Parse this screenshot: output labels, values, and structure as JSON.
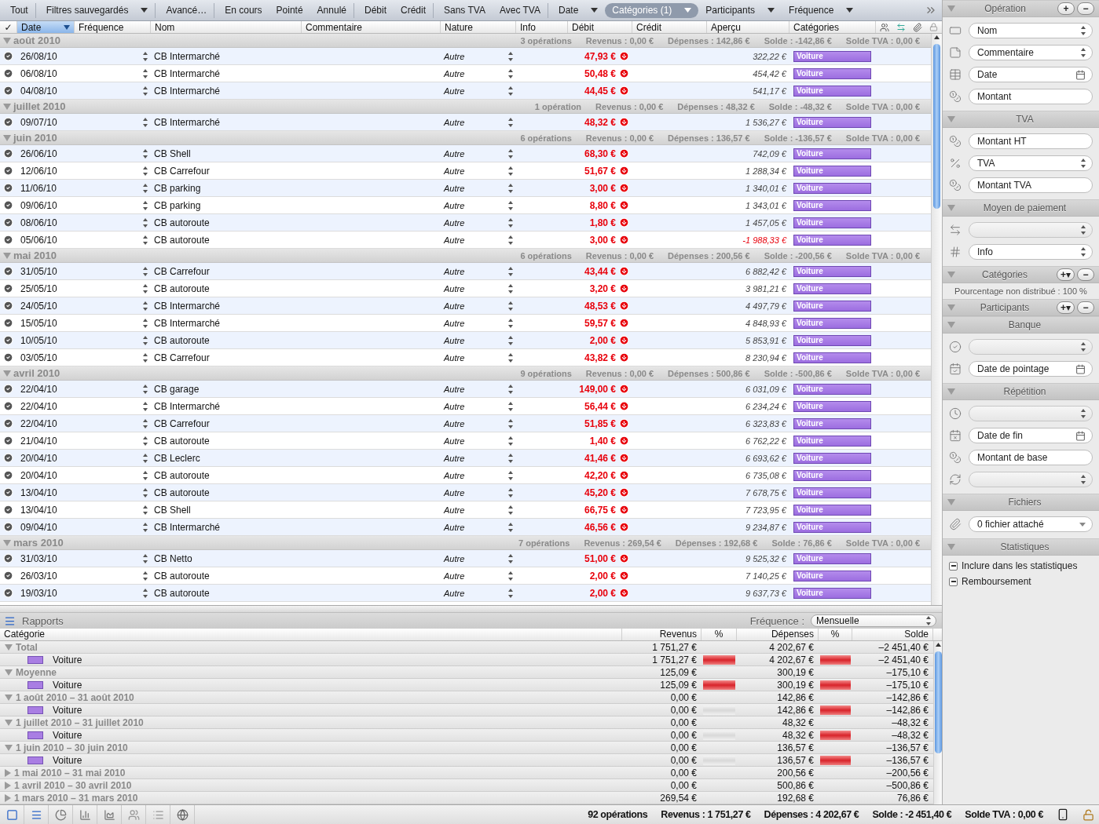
{
  "filters": [
    {
      "label": "Tout",
      "dropdown": false,
      "selected": false,
      "separator_after": true
    },
    {
      "label": "Filtres sauvegardés",
      "dropdown": true,
      "selected": false,
      "separator_after": true
    },
    {
      "label": "Avancé…",
      "dropdown": false,
      "selected": false,
      "separator_after": true
    },
    {
      "label": "En cours",
      "dropdown": false,
      "selected": false,
      "separator_after": false
    },
    {
      "label": "Pointé",
      "dropdown": false,
      "selected": false,
      "separator_after": false
    },
    {
      "label": "Annulé",
      "dropdown": false,
      "selected": false,
      "separator_after": true
    },
    {
      "label": "Débit",
      "dropdown": false,
      "selected": false,
      "separator_after": false
    },
    {
      "label": "Crédit",
      "dropdown": false,
      "selected": false,
      "separator_after": true
    },
    {
      "label": "Sans TVA",
      "dropdown": false,
      "selected": false,
      "separator_after": false
    },
    {
      "label": "Avec TVA",
      "dropdown": false,
      "selected": false,
      "separator_after": true
    },
    {
      "label": "Date",
      "dropdown": true,
      "selected": false,
      "separator_after": false
    },
    {
      "label": "Catégories (1)",
      "dropdown": true,
      "selected": true,
      "separator_after": false
    },
    {
      "label": "Participants",
      "dropdown": true,
      "selected": false,
      "separator_after": false
    },
    {
      "label": "Fréquence",
      "dropdown": true,
      "selected": false,
      "separator_after": false
    }
  ],
  "columns": [
    {
      "label": "✓",
      "selected": false
    },
    {
      "label": "Date",
      "selected": true
    },
    {
      "label": "Fréquence",
      "selected": false
    },
    {
      "label": "Nom",
      "selected": false
    },
    {
      "label": "Commentaire",
      "selected": false
    },
    {
      "label": "Nature",
      "selected": false
    },
    {
      "label": "Info",
      "selected": false
    },
    {
      "label": "Débit",
      "selected": false
    },
    {
      "label": "Crédit",
      "selected": false
    },
    {
      "label": "Aperçu",
      "selected": false
    },
    {
      "label": "Catégories",
      "selected": false
    }
  ],
  "groups": [
    {
      "month": "août 2010",
      "expanded": true,
      "summary": [
        "3 opérations",
        "Revenus : 0,00 €",
        "Dépenses : 142,86 €",
        "Solde : -142,86 €",
        "Solde TVA : 0,00 €"
      ],
      "rows": [
        {
          "checked": true,
          "date": "26/08/10",
          "name": "CB Intermarché",
          "nature": "Autre",
          "debit": "47,93 €",
          "apercu": "322,22 €",
          "negative": false,
          "category": "Voiture"
        },
        {
          "checked": true,
          "date": "06/08/10",
          "name": "CB Intermarché",
          "nature": "Autre",
          "debit": "50,48 €",
          "apercu": "454,42 €",
          "negative": false,
          "category": "Voiture"
        },
        {
          "checked": true,
          "date": "04/08/10",
          "name": "CB Intermarché",
          "nature": "Autre",
          "debit": "44,45 €",
          "apercu": "541,17 €",
          "negative": false,
          "category": "Voiture"
        }
      ]
    },
    {
      "month": "juillet 2010",
      "expanded": true,
      "summary": [
        "1 opération",
        "Revenus : 0,00 €",
        "Dépenses : 48,32 €",
        "Solde : -48,32 €",
        "Solde TVA : 0,00 €"
      ],
      "rows": [
        {
          "checked": true,
          "date": "09/07/10",
          "name": "CB Intermarché",
          "nature": "Autre",
          "debit": "48,32 €",
          "apercu": "1 536,27 €",
          "negative": false,
          "category": "Voiture"
        }
      ]
    },
    {
      "month": "juin 2010",
      "expanded": true,
      "summary": [
        "6 opérations",
        "Revenus : 0,00 €",
        "Dépenses : 136,57 €",
        "Solde : -136,57 €",
        "Solde TVA : 0,00 €"
      ],
      "rows": [
        {
          "checked": true,
          "date": "26/06/10",
          "name": "CB Shell",
          "nature": "Autre",
          "debit": "68,30 €",
          "apercu": "742,09 €",
          "negative": false,
          "category": "Voiture"
        },
        {
          "checked": true,
          "date": "12/06/10",
          "name": "CB Carrefour",
          "nature": "Autre",
          "debit": "51,67 €",
          "apercu": "1 288,34 €",
          "negative": false,
          "category": "Voiture"
        },
        {
          "checked": true,
          "date": "11/06/10",
          "name": "CB parking",
          "nature": "Autre",
          "debit": "3,00 €",
          "apercu": "1 340,01 €",
          "negative": false,
          "category": "Voiture"
        },
        {
          "checked": true,
          "date": "09/06/10",
          "name": "CB parking",
          "nature": "Autre",
          "debit": "8,80 €",
          "apercu": "1 343,01 €",
          "negative": false,
          "category": "Voiture"
        },
        {
          "checked": true,
          "date": "08/06/10",
          "name": "CB autoroute",
          "nature": "Autre",
          "debit": "1,80 €",
          "apercu": "1 457,05 €",
          "negative": false,
          "category": "Voiture"
        },
        {
          "checked": true,
          "date": "05/06/10",
          "name": "CB autoroute",
          "nature": "Autre",
          "debit": "3,00 €",
          "apercu": "-1 988,33 €",
          "negative": true,
          "category": "Voiture"
        }
      ]
    },
    {
      "month": "mai 2010",
      "expanded": true,
      "summary": [
        "6 opérations",
        "Revenus : 0,00 €",
        "Dépenses : 200,56 €",
        "Solde : -200,56 €",
        "Solde TVA : 0,00 €"
      ],
      "rows": [
        {
          "checked": true,
          "date": "31/05/10",
          "name": "CB Carrefour",
          "nature": "Autre",
          "debit": "43,44 €",
          "apercu": "6 882,42 €",
          "negative": false,
          "category": "Voiture"
        },
        {
          "checked": true,
          "date": "25/05/10",
          "name": "CB autoroute",
          "nature": "Autre",
          "debit": "3,20 €",
          "apercu": "3 981,21 €",
          "negative": false,
          "category": "Voiture"
        },
        {
          "checked": true,
          "date": "24/05/10",
          "name": "CB Intermarché",
          "nature": "Autre",
          "debit": "48,53 €",
          "apercu": "4 497,79 €",
          "negative": false,
          "category": "Voiture"
        },
        {
          "checked": true,
          "date": "15/05/10",
          "name": "CB Intermarché",
          "nature": "Autre",
          "debit": "59,57 €",
          "apercu": "4 848,93 €",
          "negative": false,
          "category": "Voiture"
        },
        {
          "checked": true,
          "date": "10/05/10",
          "name": "CB autoroute",
          "nature": "Autre",
          "debit": "2,00 €",
          "apercu": "5 853,91 €",
          "negative": false,
          "category": "Voiture"
        },
        {
          "checked": true,
          "date": "03/05/10",
          "name": "CB Carrefour",
          "nature": "Autre",
          "debit": "43,82 €",
          "apercu": "8 230,94 €",
          "negative": false,
          "category": "Voiture"
        }
      ]
    },
    {
      "month": "avril 2010",
      "expanded": true,
      "summary": [
        "9 opérations",
        "Revenus : 0,00 €",
        "Dépenses : 500,86 €",
        "Solde : -500,86 €",
        "Solde TVA : 0,00 €"
      ],
      "rows": [
        {
          "checked": true,
          "date": "22/04/10",
          "name": "CB garage",
          "nature": "Autre",
          "debit": "149,00 €",
          "apercu": "6 031,09 €",
          "negative": false,
          "category": "Voiture"
        },
        {
          "checked": true,
          "date": "22/04/10",
          "name": "CB Intermarché",
          "nature": "Autre",
          "debit": "56,44 €",
          "apercu": "6 234,24 €",
          "negative": false,
          "category": "Voiture"
        },
        {
          "checked": true,
          "date": "22/04/10",
          "name": "CB Carrefour",
          "nature": "Autre",
          "debit": "51,85 €",
          "apercu": "6 323,83 €",
          "negative": false,
          "category": "Voiture"
        },
        {
          "checked": true,
          "date": "21/04/10",
          "name": "CB autoroute",
          "nature": "Autre",
          "debit": "1,40 €",
          "apercu": "6 762,22 €",
          "negative": false,
          "category": "Voiture"
        },
        {
          "checked": true,
          "date": "20/04/10",
          "name": "CB Leclerc",
          "nature": "Autre",
          "debit": "41,46 €",
          "apercu": "6 693,62 €",
          "negative": false,
          "category": "Voiture"
        },
        {
          "checked": true,
          "date": "20/04/10",
          "name": "CB autoroute",
          "nature": "Autre",
          "debit": "42,20 €",
          "apercu": "6 735,08 €",
          "negative": false,
          "category": "Voiture"
        },
        {
          "checked": true,
          "date": "13/04/10",
          "name": "CB autoroute",
          "nature": "Autre",
          "debit": "45,20 €",
          "apercu": "7 678,75 €",
          "negative": false,
          "category": "Voiture"
        },
        {
          "checked": true,
          "date": "13/04/10",
          "name": "CB Shell",
          "nature": "Autre",
          "debit": "66,75 €",
          "apercu": "7 723,95 €",
          "negative": false,
          "category": "Voiture"
        },
        {
          "checked": true,
          "date": "09/04/10",
          "name": "CB Intermarché",
          "nature": "Autre",
          "debit": "46,56 €",
          "apercu": "9 234,87 €",
          "negative": false,
          "category": "Voiture"
        }
      ]
    },
    {
      "month": "mars 2010",
      "expanded": true,
      "summary": [
        "7 opérations",
        "Revenus : 269,54 €",
        "Dépenses : 192,68 €",
        "Solde : 76,86 €",
        "Solde TVA : 0,00 €"
      ],
      "rows": [
        {
          "checked": true,
          "date": "31/03/10",
          "name": "CB Netto",
          "nature": "Autre",
          "debit": "51,00 €",
          "apercu": "9 525,32 €",
          "negative": false,
          "category": "Voiture"
        },
        {
          "checked": true,
          "date": "26/03/10",
          "name": "CB autoroute",
          "nature": "Autre",
          "debit": "2,00 €",
          "apercu": "7 140,25 €",
          "negative": false,
          "category": "Voiture"
        },
        {
          "checked": true,
          "date": "19/03/10",
          "name": "CB autoroute",
          "nature": "Autre",
          "debit": "2,00 €",
          "apercu": "9 637,73 €",
          "negative": false,
          "category": "Voiture"
        }
      ]
    }
  ],
  "report": {
    "title": "Rapports",
    "frequency": {
      "label": "Fréquence :",
      "value": "Mensuelle"
    },
    "columns": [
      "Catégorie",
      "Revenus",
      "%",
      "Dépenses",
      "%",
      "Solde"
    ],
    "rows": [
      {
        "kind": "group",
        "label": "Total",
        "expanded": true,
        "revenus": "1 751,27 €",
        "depenses": "4 202,67 €",
        "solde": "–2 451,40 €"
      },
      {
        "kind": "category",
        "label": "Voiture",
        "revenus": "1 751,27 €",
        "revenus_bar": {
          "level": 1
        },
        "depenses": "4 202,67 €",
        "depenses_bar": {
          "level": 1
        },
        "solde": "–2 451,40 €"
      },
      {
        "kind": "group",
        "label": "Moyenne",
        "expanded": true,
        "revenus": "125,09 €",
        "depenses": "300,19 €",
        "solde": "–175,10 €"
      },
      {
        "kind": "category",
        "label": "Voiture",
        "revenus": "125,09 €",
        "revenus_bar": {
          "level": 1
        },
        "depenses": "300,19 €",
        "depenses_bar": {
          "level": 1
        },
        "solde": "–175,10 €"
      },
      {
        "kind": "group",
        "label": "1 août 2010 – 31 août 2010",
        "expanded": true,
        "revenus": "0,00 €",
        "depenses": "142,86 €",
        "solde": "–142,86 €"
      },
      {
        "kind": "category",
        "label": "Voiture",
        "revenus": "0,00 €",
        "revenus_bar": {
          "level": 0
        },
        "depenses": "142,86 €",
        "depenses_bar": {
          "level": 1
        },
        "solde": "–142,86 €"
      },
      {
        "kind": "group",
        "label": "1 juillet 2010 – 31 juillet 2010",
        "expanded": true,
        "revenus": "0,00 €",
        "depenses": "48,32 €",
        "solde": "–48,32 €"
      },
      {
        "kind": "category",
        "label": "Voiture",
        "revenus": "0,00 €",
        "revenus_bar": {
          "level": 0
        },
        "depenses": "48,32 €",
        "depenses_bar": {
          "level": 1
        },
        "solde": "–48,32 €"
      },
      {
        "kind": "group",
        "label": "1 juin 2010 – 30 juin 2010",
        "expanded": true,
        "revenus": "0,00 €",
        "depenses": "136,57 €",
        "solde": "–136,57 €"
      },
      {
        "kind": "category",
        "label": "Voiture",
        "revenus": "0,00 €",
        "revenus_bar": {
          "level": 0
        },
        "depenses": "136,57 €",
        "depenses_bar": {
          "level": 1
        },
        "solde": "–136,57 €"
      },
      {
        "kind": "group",
        "label": "1 mai 2010 – 31 mai 2010",
        "expanded": false,
        "revenus": "0,00 €",
        "depenses": "200,56 €",
        "solde": "–200,56 €"
      },
      {
        "kind": "group",
        "label": "1 avril 2010 – 30 avril 2010",
        "expanded": false,
        "revenus": "0,00 €",
        "depenses": "500,86 €",
        "solde": "–500,86 €"
      },
      {
        "kind": "group",
        "label": "1 mars 2010 – 31 mars 2010",
        "expanded": false,
        "revenus": "269,54 €",
        "depenses": "192,68 €",
        "solde": "76,86 €"
      }
    ]
  },
  "inspector": [
    {
      "title": "Opération",
      "expanded": true,
      "buttons": [
        "+",
        "−"
      ],
      "fields": [
        {
          "kind": "select",
          "label": "Nom",
          "disabled": false
        },
        {
          "kind": "select",
          "label": "Commentaire",
          "disabled": false
        },
        {
          "kind": "date",
          "label": "Date",
          "disabled": false
        },
        {
          "kind": "text",
          "label": "Montant",
          "disabled": false
        }
      ]
    },
    {
      "title": "TVA",
      "expanded": true,
      "fields": [
        {
          "kind": "text",
          "label": "Montant HT",
          "disabled": false
        },
        {
          "kind": "select",
          "label": "TVA",
          "disabled": false
        },
        {
          "kind": "text",
          "label": "Montant TVA",
          "disabled": false
        }
      ]
    },
    {
      "title": "Moyen de paiement",
      "expanded": true,
      "fields": [
        {
          "kind": "select",
          "disabled": true
        },
        {
          "kind": "select",
          "label": "Info",
          "disabled": false
        }
      ]
    },
    {
      "title": "Catégories",
      "expanded": true,
      "buttons": [
        "+▾",
        "−"
      ],
      "note": "Pourcentage non distribué : 100 %"
    },
    {
      "title": "Participants",
      "expanded": true,
      "buttons": [
        "+▾",
        "−"
      ]
    },
    {
      "title": "Banque",
      "expanded": true,
      "fields": [
        {
          "kind": "select",
          "disabled": true
        },
        {
          "kind": "date",
          "label": "Date de pointage",
          "disabled": false
        }
      ]
    },
    {
      "title": "Répétition",
      "expanded": true,
      "fields": [
        {
          "kind": "select",
          "disabled": true
        },
        {
          "kind": "date",
          "label": "Date de fin",
          "disabled": false
        },
        {
          "kind": "text",
          "label": "Montant de base",
          "disabled": false
        },
        {
          "kind": "select",
          "disabled": true
        }
      ]
    },
    {
      "title": "Fichiers",
      "expanded": true,
      "fields": [
        {
          "kind": "combo",
          "label": "0 fichier attaché",
          "disabled": false
        }
      ]
    },
    {
      "title": "Statistiques",
      "expanded": true,
      "checks": [
        {
          "label": "Inclure dans les statistiques",
          "mixed": true
        },
        {
          "label": "Remboursement",
          "mixed": true
        }
      ]
    }
  ],
  "status_bar": [
    "92 opérations",
    "Revenus : 1 751,27 €",
    "Dépenses : 4 202,67 €",
    "Solde : -2 451,40 €",
    "Solde TVA : 0,00 €"
  ]
}
